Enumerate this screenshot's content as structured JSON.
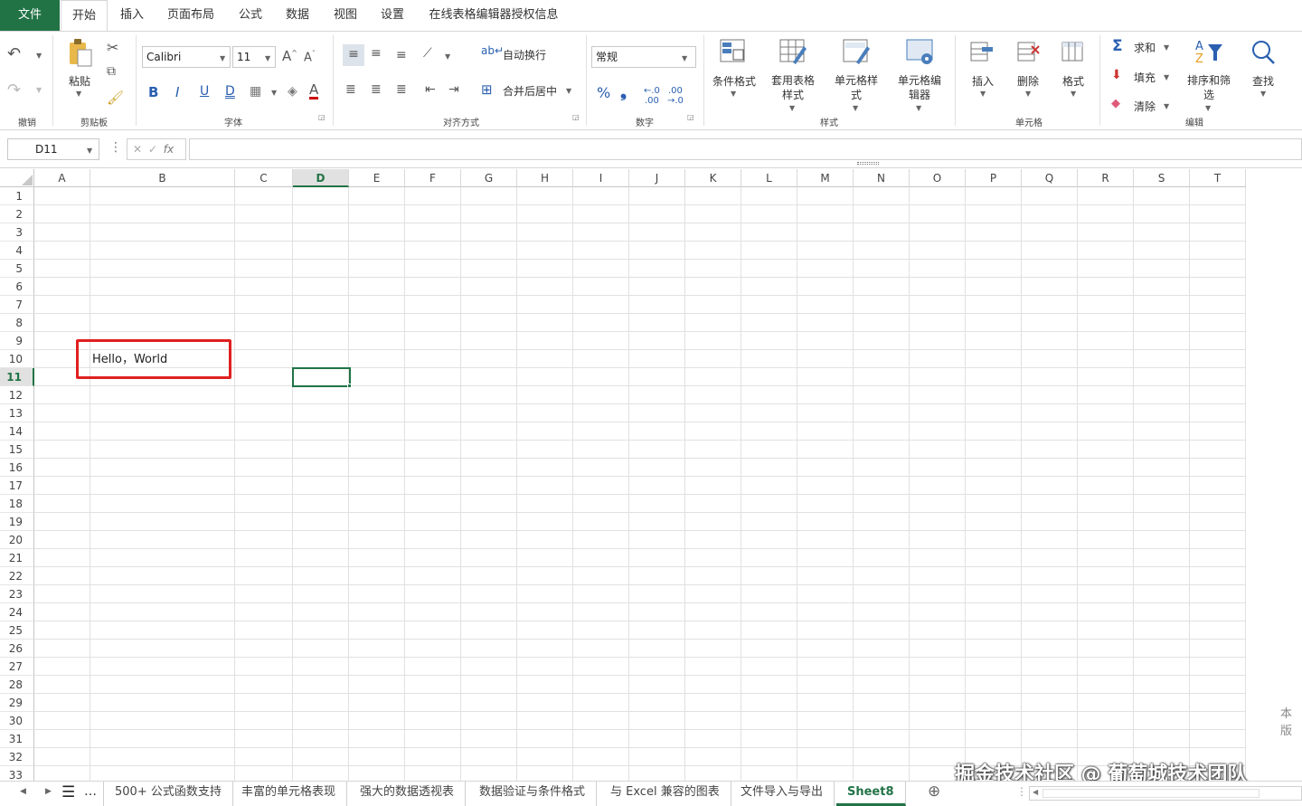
{
  "menu": {
    "tabs": [
      "文件",
      "开始",
      "插入",
      "页面布局",
      "公式",
      "数据",
      "视图",
      "设置",
      "在线表格编辑器授权信息"
    ]
  },
  "ribbon": {
    "undo": {
      "group_label": "撤销"
    },
    "clipboard": {
      "paste_label": "粘贴",
      "group_label": "剪贴板"
    },
    "font": {
      "name": "Calibri",
      "size": "11",
      "bold": "B",
      "italic": "I",
      "underline": "U",
      "double_underline": "D",
      "font_color": "A",
      "group_label": "字体"
    },
    "alignment": {
      "wrap_label": "自动换行",
      "merge_label": "合并后居中",
      "group_label": "对齐方式"
    },
    "number": {
      "format": "常规",
      "percent": "%",
      "comma": "❟",
      "group_label": "数字"
    },
    "styles": {
      "conditional_label": "条件格式",
      "table_label": "套用表格样式",
      "cell_style_label": "单元格样式",
      "cell_editor_label": "单元格编辑器",
      "group_label": "样式"
    },
    "cells": {
      "insert_label": "插入",
      "delete_label": "删除",
      "format_label": "格式",
      "group_label": "单元格"
    },
    "editing": {
      "sum_label": "求和",
      "fill_label": "填充",
      "clear_label": "清除",
      "sort_label": "排序和筛选",
      "find_label": "查找",
      "group_label": "编辑"
    }
  },
  "formula_bar": {
    "name_box": "D11",
    "fx": "fx",
    "formula": ""
  },
  "grid": {
    "columns": [
      "A",
      "B",
      "C",
      "D",
      "E",
      "F",
      "G",
      "H",
      "I",
      "J",
      "K",
      "L",
      "M",
      "N",
      "O",
      "P",
      "Q",
      "R",
      "S",
      "T"
    ],
    "rows": [
      "1",
      "2",
      "3",
      "4",
      "5",
      "6",
      "7",
      "8",
      "9",
      "10",
      "11",
      "12",
      "13",
      "14",
      "15",
      "16",
      "17",
      "18",
      "19",
      "20",
      "21",
      "22",
      "23",
      "24",
      "25",
      "26",
      "27",
      "28",
      "29",
      "30",
      "31",
      "32",
      "33"
    ],
    "active_cell": "D11",
    "cell_B10": "Hello，World"
  },
  "sheet_tabs": [
    "500+ 公式函数支持",
    "丰富的单元格表现",
    "强大的数据透视表",
    "数据验证与条件格式",
    "与 Excel 兼容的图表",
    "文件导入与导出",
    "Sheet8"
  ],
  "watermark": "掘金技术社区 @ 葡萄城技术团队",
  "side_text": "本版",
  "colors": {
    "accent": "#217346",
    "highlight": "#e02020"
  }
}
